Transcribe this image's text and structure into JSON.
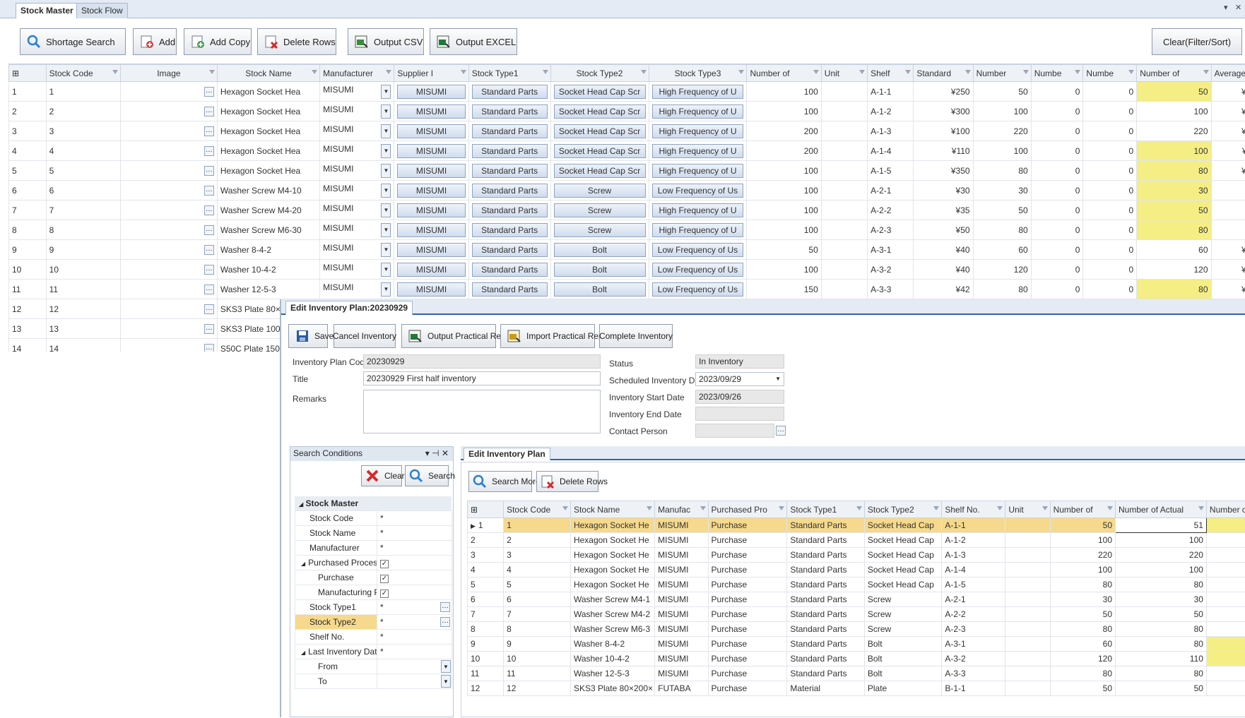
{
  "tabs": [
    "Stock Master",
    "Stock Flow"
  ],
  "window_controls": [
    "▾",
    "✕"
  ],
  "toolbar": {
    "shortage_search": "Shortage Search",
    "add": "Add",
    "add_copy": "Add Copy",
    "delete_rows": "Delete Rows",
    "output_csv": "Output CSV",
    "output_excel": "Output EXCEL",
    "clear_filter": "Clear(Filter/Sort)"
  },
  "stock_grid": {
    "columns": [
      "Stock Code",
      "Image",
      "Stock Name",
      "Manufacturer",
      "Supplier I",
      "Stock Type1",
      "Stock Type2",
      "Stock Type3",
      "Number of",
      "Unit",
      "Shelf",
      "Standard",
      "Number",
      "Numbe",
      "Numbe",
      "Number of",
      "Average I"
    ],
    "rows": [
      {
        "n": "1",
        "code": "1",
        "name": "Hexagon Socket Hea",
        "mfr": "MISUMI",
        "sup": "MISUMI",
        "t1": "Standard Parts",
        "t2": "Socket Head Cap Scr",
        "t3": "High Frequency of U",
        "num": "100",
        "unit": "",
        "shelf": "A-1-1",
        "std": "¥250",
        "n1": "50",
        "n2": "0",
        "n3": "0",
        "n4": "50",
        "avg": "¥25"
      },
      {
        "n": "2",
        "code": "2",
        "name": "Hexagon Socket Hea",
        "mfr": "MISUMI",
        "sup": "MISUMI",
        "t1": "Standard Parts",
        "t2": "Socket Head Cap Scr",
        "t3": "High Frequency of U",
        "num": "100",
        "unit": "",
        "shelf": "A-1-2",
        "std": "¥300",
        "n1": "100",
        "n2": "0",
        "n3": "0",
        "n4": "100",
        "avg": "¥30"
      },
      {
        "n": "3",
        "code": "3",
        "name": "Hexagon Socket Hea",
        "mfr": "MISUMI",
        "sup": "MISUMI",
        "t1": "Standard Parts",
        "t2": "Socket Head Cap Scr",
        "t3": "High Frequency of U",
        "num": "200",
        "unit": "",
        "shelf": "A-1-3",
        "std": "¥100",
        "n1": "220",
        "n2": "0",
        "n3": "0",
        "n4": "220",
        "avg": "¥10"
      },
      {
        "n": "4",
        "code": "4",
        "name": "Hexagon Socket Hea",
        "mfr": "MISUMI",
        "sup": "MISUMI",
        "t1": "Standard Parts",
        "t2": "Socket Head Cap Scr",
        "t3": "High Frequency of U",
        "num": "200",
        "unit": "",
        "shelf": "A-1-4",
        "std": "¥110",
        "n1": "100",
        "n2": "0",
        "n3": "0",
        "n4": "100",
        "avg": "¥11"
      },
      {
        "n": "5",
        "code": "5",
        "name": "Hexagon Socket Hea",
        "mfr": "MISUMI",
        "sup": "MISUMI",
        "t1": "Standard Parts",
        "t2": "Socket Head Cap Scr",
        "t3": "High Frequency of U",
        "num": "100",
        "unit": "",
        "shelf": "A-1-5",
        "std": "¥350",
        "n1": "80",
        "n2": "0",
        "n3": "0",
        "n4": "80",
        "avg": "¥35"
      },
      {
        "n": "6",
        "code": "6",
        "name": "Washer Screw M4-10",
        "mfr": "MISUMI",
        "sup": "MISUMI",
        "t1": "Standard Parts",
        "t2": "Screw",
        "t3": "Low Frequency of Us",
        "num": "100",
        "unit": "",
        "shelf": "A-2-1",
        "std": "¥30",
        "n1": "30",
        "n2": "0",
        "n3": "0",
        "n4": "30",
        "avg": "¥3"
      },
      {
        "n": "7",
        "code": "7",
        "name": "Washer Screw M4-20",
        "mfr": "MISUMI",
        "sup": "MISUMI",
        "t1": "Standard Parts",
        "t2": "Screw",
        "t3": "High Frequency of U",
        "num": "100",
        "unit": "",
        "shelf": "A-2-2",
        "std": "¥35",
        "n1": "50",
        "n2": "0",
        "n3": "0",
        "n4": "50",
        "avg": "¥3"
      },
      {
        "n": "8",
        "code": "8",
        "name": "Washer Screw M6-30",
        "mfr": "MISUMI",
        "sup": "MISUMI",
        "t1": "Standard Parts",
        "t2": "Screw",
        "t3": "High Frequency of U",
        "num": "100",
        "unit": "",
        "shelf": "A-2-3",
        "std": "¥50",
        "n1": "80",
        "n2": "0",
        "n3": "0",
        "n4": "80",
        "avg": "¥5"
      },
      {
        "n": "9",
        "code": "9",
        "name": "Washer 8-4-2",
        "mfr": "MISUMI",
        "sup": "MISUMI",
        "t1": "Standard Parts",
        "t2": "Bolt",
        "t3": "Low Frequency of Us",
        "num": "50",
        "unit": "",
        "shelf": "A-3-1",
        "std": "¥40",
        "n1": "60",
        "n2": "0",
        "n3": "0",
        "n4": "60",
        "avg": "¥25"
      },
      {
        "n": "10",
        "code": "10",
        "name": "Washer 10-4-2",
        "mfr": "MISUMI",
        "sup": "MISUMI",
        "t1": "Standard Parts",
        "t2": "Bolt",
        "t3": "Low Frequency of Us",
        "num": "100",
        "unit": "",
        "shelf": "A-3-2",
        "std": "¥40",
        "n1": "120",
        "n2": "0",
        "n3": "0",
        "n4": "120",
        "avg": "¥30"
      },
      {
        "n": "11",
        "code": "11",
        "name": "Washer 12-5-3",
        "mfr": "MISUMI",
        "sup": "MISUMI",
        "t1": "Standard Parts",
        "t2": "Bolt",
        "t3": "Low Frequency of Us",
        "num": "150",
        "unit": "",
        "shelf": "A-3-3",
        "std": "¥42",
        "n1": "80",
        "n2": "0",
        "n3": "0",
        "n4": "80",
        "avg": "¥10"
      }
    ],
    "yellow_rows": [
      0,
      3,
      4,
      5,
      6,
      7,
      10
    ],
    "extra_rows": [
      {
        "n": "12",
        "code": "12",
        "name": "SKS3 Plate 80×200×8"
      },
      {
        "n": "13",
        "code": "13",
        "name": "SKS3 Plate 100×200×"
      },
      {
        "n": "14",
        "code": "14",
        "name": "S50C Plate 150×150×"
      }
    ]
  },
  "edit_plan": {
    "tab": "Edit Inventory Plan:20230929",
    "toolbar": {
      "save": "Save",
      "cancel": "Cancel Inventory",
      "output_report": "Output Practical Report",
      "import_report": "Import Practical Report",
      "complete": "Complete Inventory"
    },
    "form": {
      "plan_code_label": "Inventory Plan Code",
      "plan_code": "20230929",
      "title_label": "Title",
      "title": "20230929 First half inventory",
      "remarks_label": "Remarks",
      "status_label": "Status",
      "status": "In Inventory",
      "scheduled_label": "Scheduled Inventory Date",
      "scheduled": "2023/09/29",
      "start_label": "Inventory Start Date",
      "start": "2023/09/26",
      "end_label": "Inventory End Date",
      "contact_label": "Contact Person"
    }
  },
  "search_panel": {
    "title": "Search Conditions",
    "controls": "▾ ⊣ ✕",
    "clear": "Clear",
    "search": "Search",
    "group": "Stock Master",
    "items": [
      {
        "label": "Stock Code",
        "value": "*",
        "indent": 1
      },
      {
        "label": "Stock Name",
        "value": "*",
        "indent": 1
      },
      {
        "label": "Manufacturer",
        "value": "*",
        "indent": 1
      },
      {
        "label": "Purchased Processin...",
        "value": "check",
        "indent": 0,
        "expander": "◢"
      },
      {
        "label": "Purchase",
        "value": "check",
        "indent": 2
      },
      {
        "label": "Manufacturing Part",
        "value": "check",
        "indent": 2
      },
      {
        "label": "Stock Type1",
        "value": "*",
        "indent": 1,
        "ellipsis": true
      },
      {
        "label": "Stock Type2",
        "value": "*",
        "indent": 1,
        "ellipsis": true,
        "selected": true
      },
      {
        "label": "Shelf No.",
        "value": "*",
        "indent": 1
      },
      {
        "label": "Last Inventory Date",
        "value": "*",
        "indent": 0,
        "expander": "◢"
      },
      {
        "label": "From",
        "value": "",
        "indent": 2,
        "dropdown": true
      },
      {
        "label": "To",
        "value": "",
        "indent": 2,
        "dropdown": true
      }
    ]
  },
  "plan_grid": {
    "tab": "Edit Inventory Plan",
    "search_more": "Search More",
    "delete_rows": "Delete Rows",
    "columns": [
      "Stock Code",
      "Stock Name",
      "Manufac",
      "Purchased Pro",
      "Stock Type1",
      "Stock Type2",
      "Shelf No.",
      "Unit",
      "Number of",
      "Number of Actual",
      "Number of"
    ],
    "rows": [
      {
        "n": "1",
        "code": "1",
        "name": "Hexagon Socket He",
        "mfr": "MISUMI",
        "pur": "Purchase",
        "t1": "Standard Parts",
        "t2": "Socket Head Cap",
        "shelf": "A-1-1",
        "unit": "",
        "num": "50",
        "act": "51"
      },
      {
        "n": "2",
        "code": "2",
        "name": "Hexagon Socket He",
        "mfr": "MISUMI",
        "pur": "Purchase",
        "t1": "Standard Parts",
        "t2": "Socket Head Cap",
        "shelf": "A-1-2",
        "unit": "",
        "num": "100",
        "act": "100"
      },
      {
        "n": "3",
        "code": "3",
        "name": "Hexagon Socket He",
        "mfr": "MISUMI",
        "pur": "Purchase",
        "t1": "Standard Parts",
        "t2": "Socket Head Cap",
        "shelf": "A-1-3",
        "unit": "",
        "num": "220",
        "act": "220"
      },
      {
        "n": "4",
        "code": "4",
        "name": "Hexagon Socket He",
        "mfr": "MISUMI",
        "pur": "Purchase",
        "t1": "Standard Parts",
        "t2": "Socket Head Cap",
        "shelf": "A-1-4",
        "unit": "",
        "num": "100",
        "act": "100"
      },
      {
        "n": "5",
        "code": "5",
        "name": "Hexagon Socket He",
        "mfr": "MISUMI",
        "pur": "Purchase",
        "t1": "Standard Parts",
        "t2": "Socket Head Cap",
        "shelf": "A-1-5",
        "unit": "",
        "num": "80",
        "act": "80"
      },
      {
        "n": "6",
        "code": "6",
        "name": "Washer Screw M4-1",
        "mfr": "MISUMI",
        "pur": "Purchase",
        "t1": "Standard Parts",
        "t2": "Screw",
        "shelf": "A-2-1",
        "unit": "",
        "num": "30",
        "act": "30"
      },
      {
        "n": "7",
        "code": "7",
        "name": "Washer Screw M4-2",
        "mfr": "MISUMI",
        "pur": "Purchase",
        "t1": "Standard Parts",
        "t2": "Screw",
        "shelf": "A-2-2",
        "unit": "",
        "num": "50",
        "act": "50"
      },
      {
        "n": "8",
        "code": "8",
        "name": "Washer Screw M6-3",
        "mfr": "MISUMI",
        "pur": "Purchase",
        "t1": "Standard Parts",
        "t2": "Screw",
        "shelf": "A-2-3",
        "unit": "",
        "num": "80",
        "act": "80"
      },
      {
        "n": "9",
        "code": "9",
        "name": "Washer 8-4-2",
        "mfr": "MISUMI",
        "pur": "Purchase",
        "t1": "Standard Parts",
        "t2": "Bolt",
        "shelf": "A-3-1",
        "unit": "",
        "num": "60",
        "act": "80"
      },
      {
        "n": "10",
        "code": "10",
        "name": "Washer 10-4-2",
        "mfr": "MISUMI",
        "pur": "Purchase",
        "t1": "Standard Parts",
        "t2": "Bolt",
        "shelf": "A-3-2",
        "unit": "",
        "num": "120",
        "act": "110"
      },
      {
        "n": "11",
        "code": "11",
        "name": "Washer 12-5-3",
        "mfr": "MISUMI",
        "pur": "Purchase",
        "t1": "Standard Parts",
        "t2": "Bolt",
        "shelf": "A-3-3",
        "unit": "",
        "num": "80",
        "act": "80"
      },
      {
        "n": "12",
        "code": "12",
        "name": "SKS3 Plate 80×200×",
        "mfr": "FUTABA",
        "pur": "Purchase",
        "t1": "Material",
        "t2": "Plate",
        "shelf": "B-1-1",
        "unit": "",
        "num": "50",
        "act": "50"
      }
    ],
    "yellow_last_col": [
      0,
      8,
      9
    ]
  },
  "colors": {
    "highlight": "#f4ee84",
    "selected_row": "#f6d98c",
    "header_bg": "#eef2f7"
  }
}
